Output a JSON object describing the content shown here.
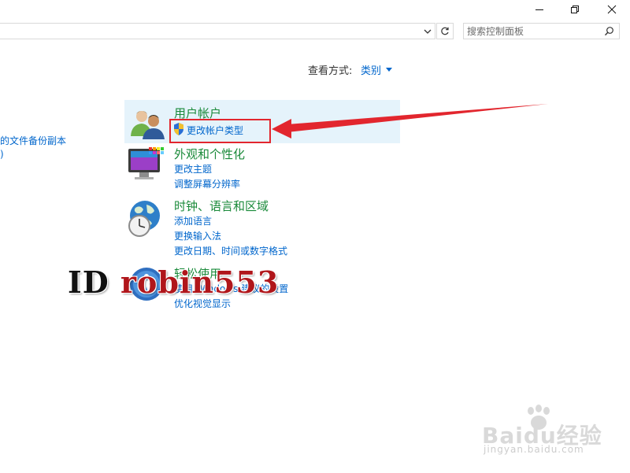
{
  "window": {
    "minimize_icon": "minimize-icon",
    "maximize_icon": "restore-icon",
    "close_icon": "close-icon"
  },
  "toolbar": {
    "address_value": "",
    "search_placeholder": "搜索控制面板"
  },
  "view_by": {
    "label": "查看方式:",
    "value": "类别"
  },
  "left_column": {
    "items": [
      "的文件备份副本",
      ")"
    ]
  },
  "categories": [
    {
      "title": "用户帐户",
      "icon": "users-icon",
      "links": [
        "更改帐户类型"
      ]
    },
    {
      "title": "外观和个性化",
      "icon": "monitor-icon",
      "links": [
        "更改主题",
        "调整屏幕分辨率"
      ]
    },
    {
      "title": "时钟、语言和区域",
      "icon": "globe-clock-icon",
      "links": [
        "添加语言",
        "更换输入法",
        "更改日期、时间或数字格式"
      ]
    },
    {
      "title": "轻松使用",
      "icon": "ease-of-access-icon",
      "links": [
        "使用 Windows 建议的设置",
        "优化视觉显示"
      ]
    }
  ],
  "annotation": {
    "highlight_color": "#e2262e"
  },
  "watermark": {
    "prefix": "ID",
    "name": "robin553"
  },
  "baidu_watermark": {
    "brand": "Baidu经验",
    "url": "jingyan.baidu.com"
  },
  "colors": {
    "link": "#0066cc",
    "category_title": "#1a8a3a",
    "hover_bg": "#e5f3fb"
  }
}
